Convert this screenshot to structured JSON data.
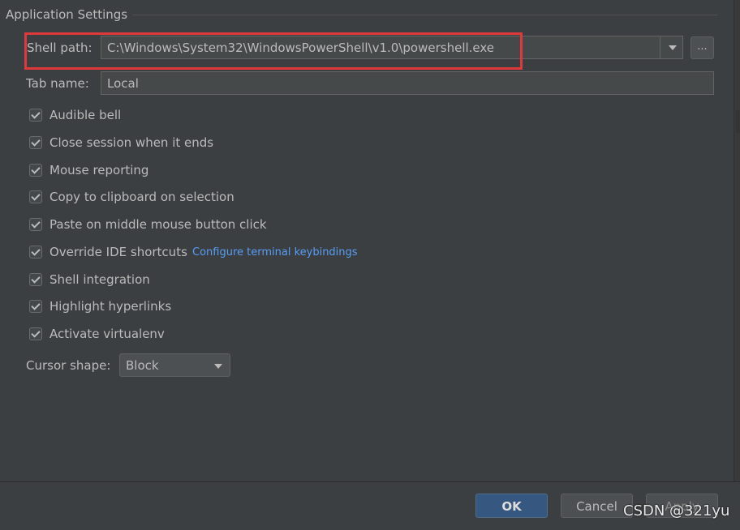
{
  "section": {
    "title": "Application Settings"
  },
  "shell_path": {
    "label": "Shell path:",
    "value": "C:\\Windows\\System32\\WindowsPowerShell\\v1.0\\powershell.exe",
    "browse_label": "..."
  },
  "tab_name": {
    "label": "Tab name:",
    "value": "Local"
  },
  "options": [
    {
      "label": "Audible bell",
      "checked": true
    },
    {
      "label": "Close session when it ends",
      "checked": true
    },
    {
      "label": "Mouse reporting",
      "checked": true
    },
    {
      "label": "Copy to clipboard on selection",
      "checked": true
    },
    {
      "label": "Paste on middle mouse button click",
      "checked": true
    },
    {
      "label": "Override IDE shortcuts",
      "checked": true
    },
    {
      "label": "Shell integration",
      "checked": true
    },
    {
      "label": "Highlight hyperlinks",
      "checked": true
    },
    {
      "label": "Activate virtualenv",
      "checked": true
    }
  ],
  "keybindings_link": "Configure terminal keybindings",
  "cursor_shape": {
    "label": "Cursor shape:",
    "value": "Block"
  },
  "buttons": {
    "ok": "OK",
    "cancel": "Cancel",
    "apply": "Apply"
  },
  "watermark": "CSDN @321yu",
  "colors": {
    "background": "#3c3f41",
    "field_bg": "#45494a",
    "text": "#bbbbbb",
    "link": "#589df6",
    "ok_button": "#365880",
    "highlight_box": "#e0393b"
  },
  "icons": {
    "dropdown": "chevron-down-icon",
    "checkbox": "checkmark-icon"
  }
}
